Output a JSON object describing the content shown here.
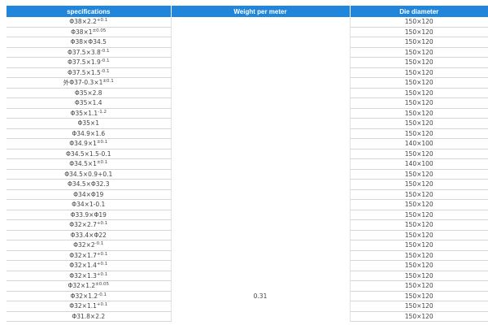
{
  "table": {
    "headers": [
      "specifications",
      "Weight per meter",
      "Die diameter"
    ],
    "rows": [
      {
        "base": "Φ38×2.2",
        "sup": "+0.1",
        "die": "150×120"
      },
      {
        "base": "Φ38×1",
        "sup": "±0.05",
        "die": "150×120"
      },
      {
        "base": "Φ38×Φ34.5",
        "sup": "",
        "die": "150×120"
      },
      {
        "base": "Φ37.5×3.8",
        "sup": "-0.1",
        "die": "150×120"
      },
      {
        "base": "Φ37.5×1.9",
        "sup": "-0.1",
        "die": "150×120"
      },
      {
        "base": "Φ37.5×1.5",
        "sup": "-0.1",
        "die": "150×120"
      },
      {
        "base": "外Φ37-0.3×1",
        "sup": "±0.1",
        "die": "150×120"
      },
      {
        "base": "Φ35×2.8",
        "sup": "",
        "die": "150×120"
      },
      {
        "base": "Φ35×1.4",
        "sup": "",
        "die": "150×120"
      },
      {
        "base": "Φ35×1.1",
        "sup": "-1.2",
        "die": "150×120"
      },
      {
        "base": "Φ35×1",
        "sup": "",
        "die": "150×120"
      },
      {
        "base": "Φ34.9×1.6",
        "sup": "",
        "die": "150×120"
      },
      {
        "base": "Φ34.9×1",
        "sup": "±0.1",
        "die": "140×100"
      },
      {
        "base": "Φ34.5×1.5-0.1",
        "sup": "",
        "die": "150×120"
      },
      {
        "base": "Φ34.5×1",
        "sup": "±0.1",
        "die": "140×100"
      },
      {
        "base": "Φ34.5×0.9+0.1",
        "sup": "",
        "die": "150×120"
      },
      {
        "base": "Φ34.5×Φ32.3",
        "sup": "",
        "die": "150×120"
      },
      {
        "base": "Φ34×Φ19",
        "sup": "",
        "die": "150×120"
      },
      {
        "base": "Φ34×1-0.1",
        "sup": "",
        "die": "150×120"
      },
      {
        "base": "Φ33.9×Φ19",
        "sup": "",
        "die": "150×120"
      },
      {
        "base": "Φ32×2.7",
        "sup": "+0.1",
        "die": "150×120"
      },
      {
        "base": "Φ33.4×Φ22",
        "sup": "",
        "die": "150×120"
      },
      {
        "base": "Φ32×2",
        "sup": "-0.1",
        "die": "150×120"
      },
      {
        "base": "Φ32×1.7",
        "sup": "+0.1",
        "die": "150×120"
      },
      {
        "base": "Φ32×1.4",
        "sup": "+0.1",
        "die": "150×120"
      },
      {
        "base": "Φ32×1.3",
        "sup": "+0.1",
        "die": "150×120"
      },
      {
        "base": "Φ32×1.2",
        "sup": "±0.05",
        "die": "150×120"
      },
      {
        "base": "Φ32×1.2",
        "sup": "-0.1",
        "die": "150×120"
      },
      {
        "base": "Φ32×1.1",
        "sup": "+0.1",
        "die": "150×120"
      },
      {
        "base": "Φ31.8×2.2",
        "sup": "",
        "die": "150×120"
      }
    ],
    "weight_value": "0.31"
  },
  "colors": {
    "header_bg": "#1f86db",
    "header_text": "#ffffff",
    "cell_text": "#444444",
    "row_border": "#d6d6d6"
  }
}
